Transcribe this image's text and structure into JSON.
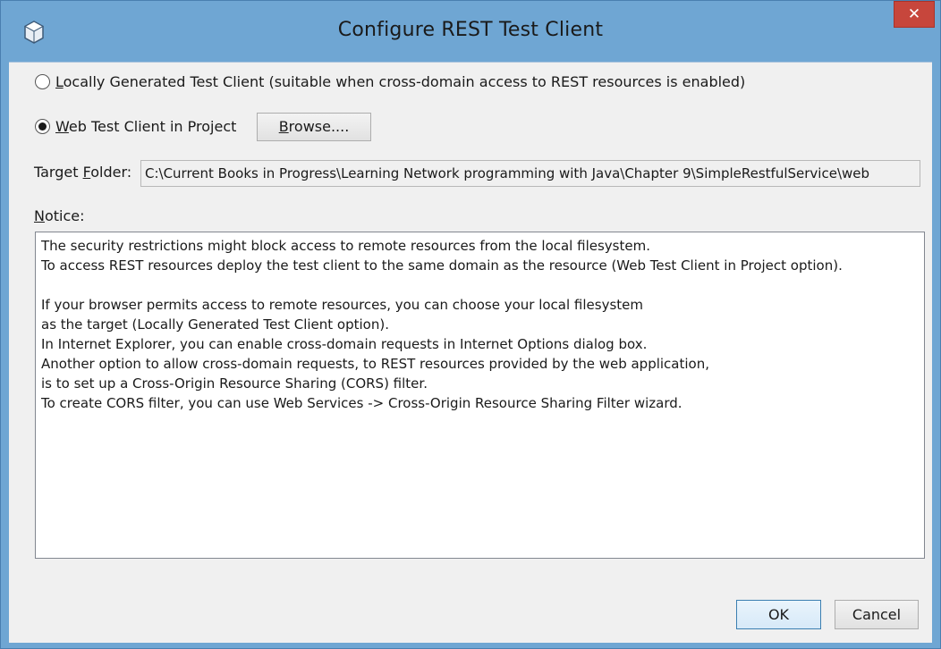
{
  "window": {
    "title": "Configure REST Test Client",
    "close_label": "✕",
    "colors": {
      "frame": "#6fa6d3",
      "close": "#c7463c",
      "client": "#f0f0f0"
    }
  },
  "options": {
    "local": {
      "mnemonic": "L",
      "label_rest": "ocally Generated Test Client (suitable when cross-domain access to REST resources is enabled)",
      "selected": false
    },
    "web": {
      "mnemonic": "W",
      "label_rest": "eb Test Client in Project",
      "selected": true
    },
    "browse": {
      "mnemonic": "B",
      "label_rest": "rowse...."
    }
  },
  "target_folder": {
    "label_pre": "Target ",
    "mnemonic": "F",
    "label_post": "older:",
    "value": "C:\\Current Books in Progress\\Learning Network programming with Java\\Chapter 9\\SimpleRestfulService\\web"
  },
  "notice": {
    "mnemonic": "N",
    "label_rest": "otice:",
    "lines": [
      "The security restrictions might block access to remote resources from the local filesystem.",
      "To access REST resources deploy the test client to the same domain as the resource (Web Test Client in Project option).",
      "",
      "If your browser permits access to remote resources, you can choose your local filesystem",
      "as the target (Locally Generated Test Client option).",
      "In Internet Explorer, you can enable cross-domain requests in Internet Options dialog box.",
      "Another option to allow cross-domain requests, to REST resources provided by the web application,",
      "is to set up a Cross-Origin Resource Sharing (CORS) filter.",
      "To create CORS filter, you can use Web Services -> Cross-Origin Resource Sharing Filter wizard."
    ]
  },
  "buttons": {
    "ok": "OK",
    "cancel": "Cancel"
  }
}
